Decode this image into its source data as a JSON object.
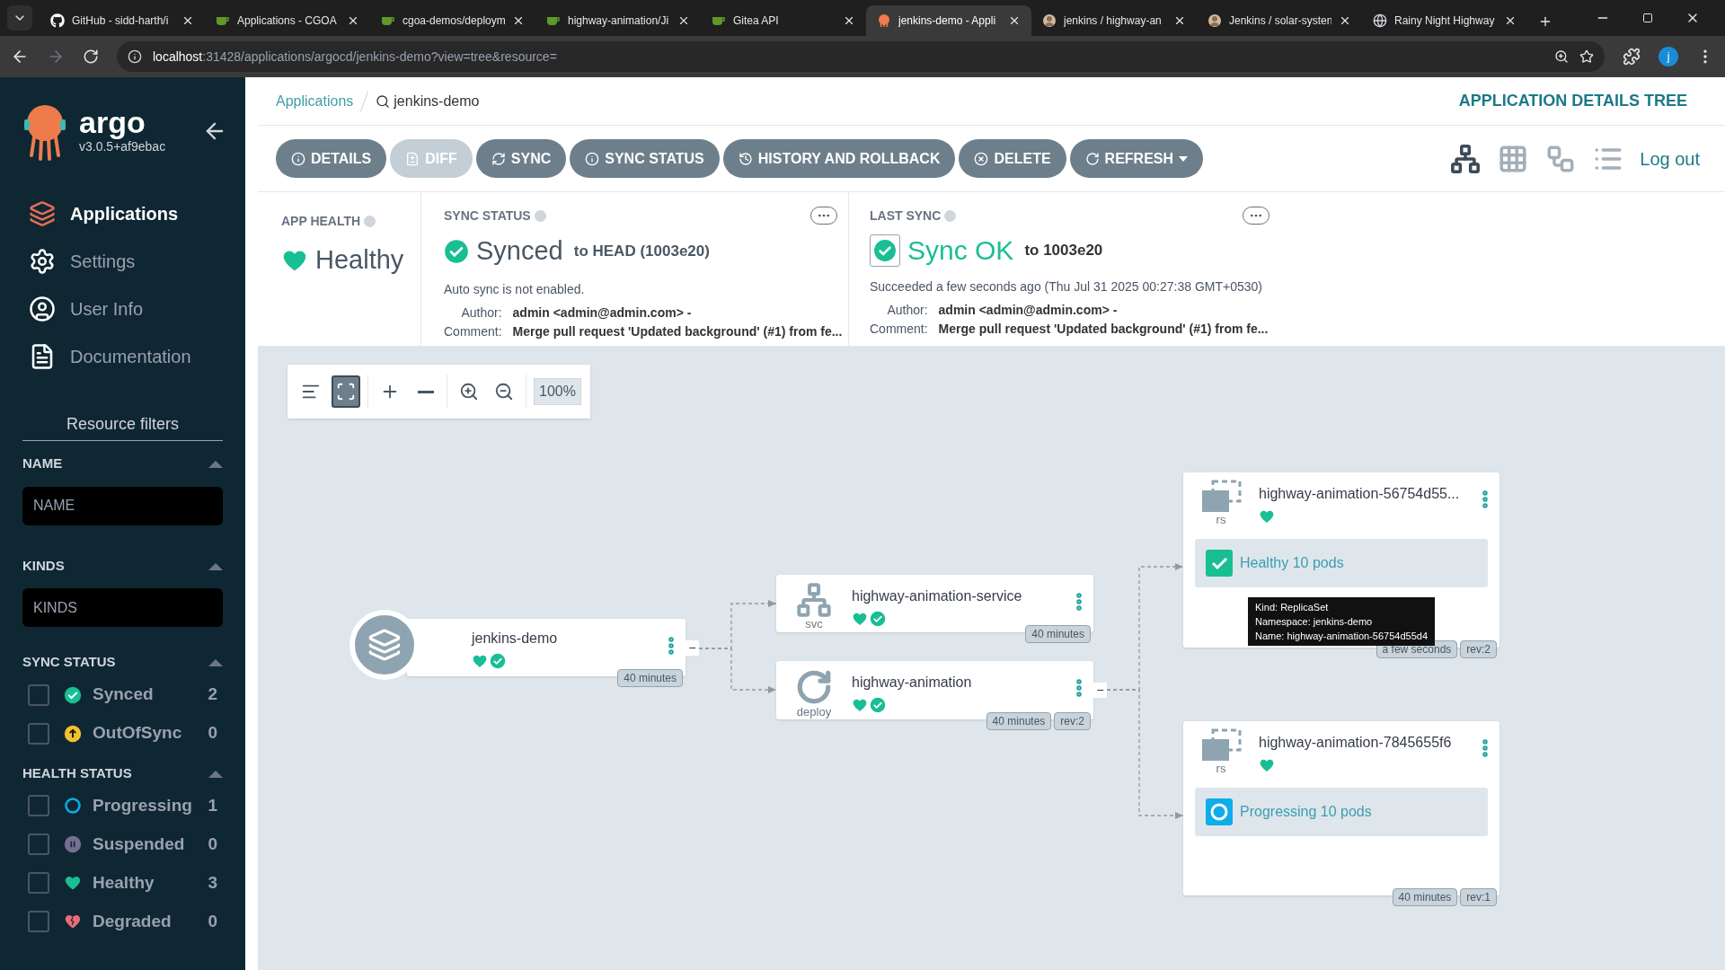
{
  "browser": {
    "tabs": [
      {
        "title": "GitHub - sidd-harth/i",
        "kind": "github",
        "selected": false
      },
      {
        "title": "Applications - CGOA",
        "kind": "gitea",
        "selected": false
      },
      {
        "title": "cgoa-demos/deploym",
        "kind": "gitea",
        "selected": false
      },
      {
        "title": "highway-animation/Ji",
        "kind": "gitea",
        "selected": false
      },
      {
        "title": "Gitea API",
        "kind": "gitea",
        "selected": false
      },
      {
        "title": "jenkins-demo - Appli",
        "kind": "argo",
        "selected": true
      },
      {
        "title": "jenkins / highway-an",
        "kind": "jenkins",
        "selected": false
      },
      {
        "title": "Jenkins / solar-systen",
        "kind": "jenkins",
        "selected": false
      },
      {
        "title": "Rainy Night Highway",
        "kind": "globe",
        "selected": false
      }
    ],
    "url_host": "localhost",
    "url_path": ":31428/applications/argocd/jenkins-demo?view=tree&resource=",
    "profile": "j"
  },
  "sidebar": {
    "brand": "argo",
    "version": "v3.0.5+af9ebac",
    "nav": [
      {
        "label": "Applications",
        "kind": "applications",
        "selected": true
      },
      {
        "label": "Settings",
        "kind": "settings",
        "selected": false
      },
      {
        "label": "User Info",
        "kind": "user",
        "selected": false
      },
      {
        "label": "Documentation",
        "kind": "docs",
        "selected": false
      }
    ],
    "filters_title": "Resource filters",
    "name_filter": {
      "label": "NAME",
      "placeholder": "NAME"
    },
    "kinds_filter": {
      "label": "KINDS",
      "placeholder": "KINDS"
    },
    "groups": [
      {
        "label": "SYNC STATUS",
        "items": [
          {
            "label": "Synced",
            "kind": "synced",
            "count": "2",
            "checked": false
          },
          {
            "label": "OutOfSync",
            "kind": "out_of_sync",
            "count": "0",
            "checked": false
          }
        ]
      },
      {
        "label": "HEALTH STATUS",
        "items": [
          {
            "label": "Progressing",
            "kind": "progressing",
            "count": "1",
            "checked": false
          },
          {
            "label": "Suspended",
            "kind": "suspended",
            "count": "0",
            "checked": false
          },
          {
            "label": "Healthy",
            "kind": "healthy",
            "count": "3",
            "checked": false
          },
          {
            "label": "Degraded",
            "kind": "degraded",
            "count": "0",
            "checked": false
          }
        ]
      }
    ]
  },
  "header": {
    "breadcrumb": "Applications",
    "app_name": "jenkins-demo",
    "title": "APPLICATION DETAILS TREE"
  },
  "actions": [
    {
      "label": "DETAILS",
      "kind": "details",
      "disabled": false
    },
    {
      "label": "DIFF",
      "kind": "diff",
      "disabled": true
    },
    {
      "label": "SYNC",
      "kind": "sync",
      "disabled": false
    },
    {
      "label": "SYNC STATUS",
      "kind": "sync_status",
      "disabled": false
    },
    {
      "label": "HISTORY AND ROLLBACK",
      "kind": "history",
      "disabled": false
    },
    {
      "label": "DELETE",
      "kind": "delete",
      "disabled": false
    },
    {
      "label": "REFRESH",
      "kind": "refresh",
      "disabled": false
    }
  ],
  "views": [
    {
      "kind": "tree",
      "selected": true
    },
    {
      "kind": "pods",
      "selected": false
    },
    {
      "kind": "network",
      "selected": false
    },
    {
      "kind": "list",
      "selected": false
    }
  ],
  "logout": "Log out",
  "status": {
    "app_health": {
      "label": "APP HEALTH",
      "value": "Healthy"
    },
    "sync_status": {
      "label": "SYNC STATUS",
      "value": "Synced",
      "target": "to HEAD (1003e20)",
      "note": "Auto sync is not enabled.",
      "author_label": "Author:",
      "author": "admin <admin@admin.com> -",
      "comment_label": "Comment:",
      "comment": "Merge pull request 'Updated background' (#1) from fe..."
    },
    "last_sync": {
      "label": "LAST SYNC",
      "value": "Sync OK",
      "target": "to 1003e20",
      "note": "Succeeded a few seconds ago (Thu Jul 31 2025 00:27:38 GMT+0530)",
      "author_label": "Author:",
      "author": "admin <admin@admin.com> -",
      "comment_label": "Comment:",
      "comment": "Merge pull request 'Updated background' (#1) from fe..."
    }
  },
  "graph": {
    "tools": [
      {
        "kind": "legend",
        "selected": false
      },
      {
        "kind": "fit",
        "selected": true
      },
      {
        "kind": "expand",
        "selected": false
      },
      {
        "kind": "collapse",
        "selected": false
      },
      {
        "kind": "zoom_in",
        "selected": false
      },
      {
        "kind": "zoom_out",
        "selected": false
      }
    ],
    "zoom": "100%",
    "nodes": [
      {
        "name": "jenkins-demo",
        "kind": "app",
        "healthy": true,
        "synced": true,
        "badges": [
          "40 minutes"
        ],
        "toggle": "−"
      },
      {
        "name": "highway-animation-service",
        "kind": "svc",
        "kind_label": "svc",
        "healthy": true,
        "synced": true,
        "badges": [
          "40 minutes"
        ]
      },
      {
        "name": "highway-animation",
        "kind": "deploy",
        "kind_label": "deploy",
        "healthy": true,
        "synced": true,
        "badges": [
          "40 minutes",
          "rev:2"
        ],
        "toggle": "−"
      },
      {
        "name": "highway-animation-56754d55...",
        "kind": "rs",
        "kind_label": "rs",
        "healthy": true,
        "badges": [
          "a few seconds",
          "rev:2"
        ],
        "pods": {
          "label": "Healthy 10 pods",
          "kind": "healthy"
        }
      },
      {
        "name": "highway-animation-7845655f6",
        "kind": "rs",
        "kind_label": "rs",
        "healthy": true,
        "badges": [
          "40 minutes",
          "rev:1"
        ],
        "pods": {
          "label": "Progressing 10 pods",
          "kind": "progressing"
        }
      }
    ],
    "tooltip": [
      "Kind: ReplicaSet",
      "Namespace: jenkins-demo",
      "Name: highway-animation-56754d55d4"
    ]
  }
}
